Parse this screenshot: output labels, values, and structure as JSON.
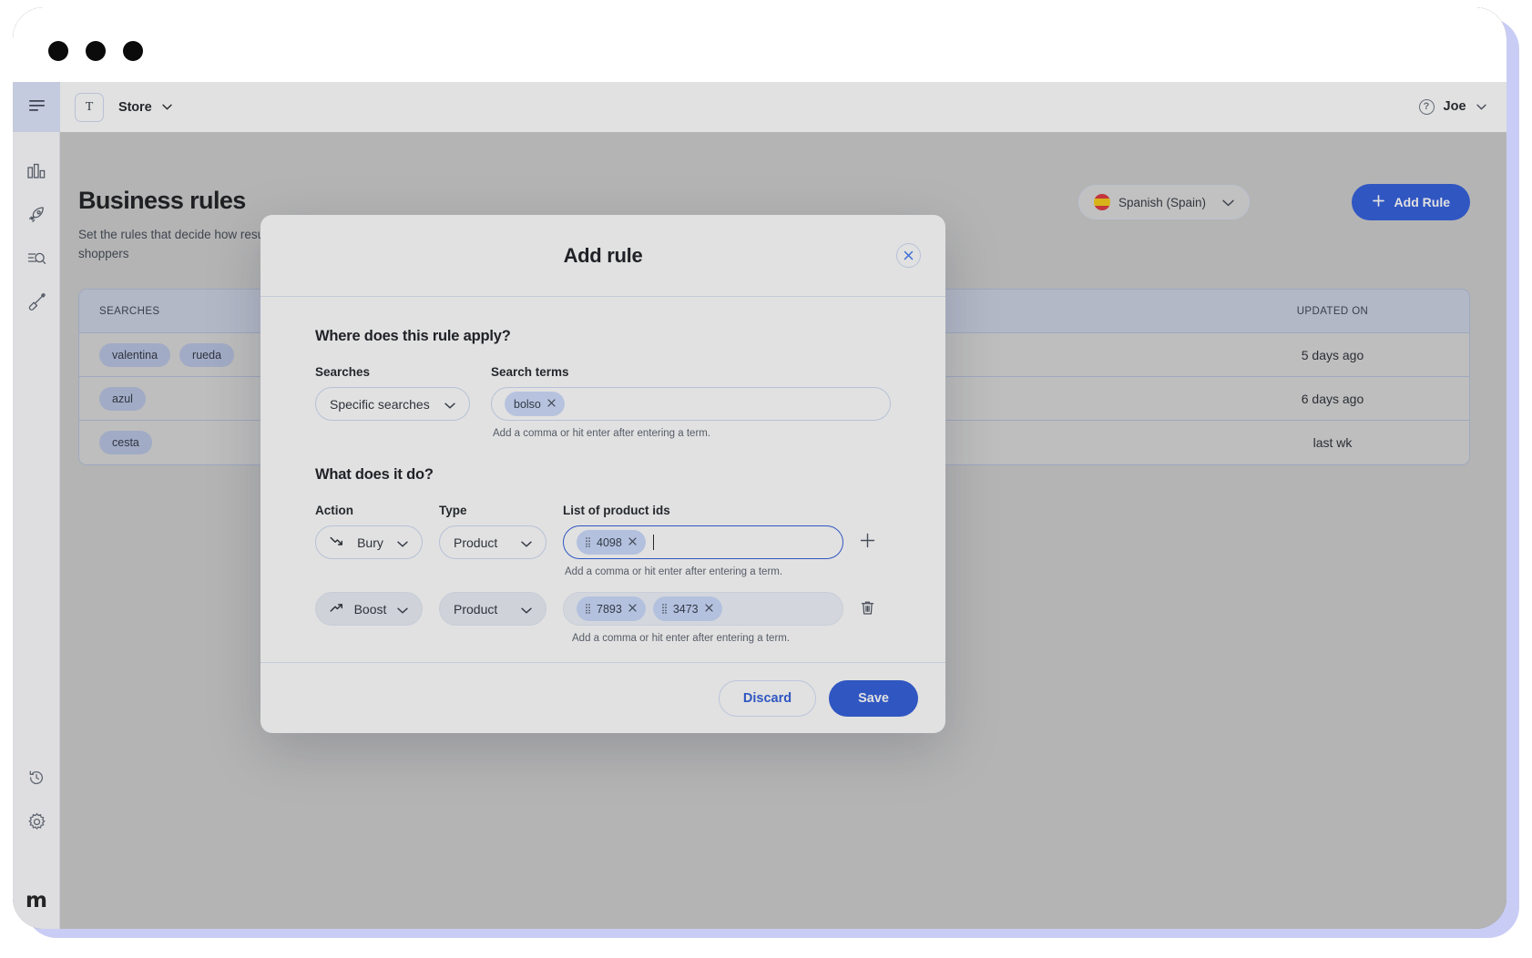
{
  "window": {
    "traffic_lights": [
      "close",
      "minimize",
      "maximize"
    ]
  },
  "appbar": {
    "store_tile_letter": "T",
    "store_name": "Store",
    "store_chevron": "chevron-down-icon",
    "help_glyph": "?",
    "user_name": "Joe",
    "user_chevron": "chevron-down-icon"
  },
  "sidebar": {
    "items": [
      {
        "icon": "hamburger-menu-icon",
        "name": "menu",
        "active": true
      },
      {
        "icon": "bar-chart-icon",
        "name": "analytics"
      },
      {
        "icon": "rocket-icon",
        "name": "boost"
      },
      {
        "icon": "search-document-icon",
        "name": "search-insights"
      },
      {
        "icon": "paintbrush-icon",
        "name": "appearance"
      }
    ],
    "bottom_items": [
      {
        "icon": "history-icon",
        "name": "history"
      },
      {
        "icon": "gear-icon",
        "name": "settings"
      }
    ],
    "logo": "m"
  },
  "page": {
    "title": "Business rules",
    "subtitle": "Set the rules that decide how results are displayed to shoppers",
    "language_selector": {
      "flag": "spain-flag-icon",
      "value": "Spanish (Spain)",
      "chevron": "chevron-down-icon"
    },
    "add_rule_button": {
      "label": "Add Rule",
      "icon": "plus-icon"
    },
    "table": {
      "columns": [
        "SEARCHES",
        "UPDATED ON"
      ],
      "rows": [
        {
          "tags": [
            "valentina",
            "rueda"
          ],
          "updated": "5 days ago"
        },
        {
          "tags": [
            "azul"
          ],
          "updated": "6 days ago"
        },
        {
          "tags": [
            "cesta"
          ],
          "updated": "last wk"
        }
      ]
    }
  },
  "modal": {
    "title": "Add rule",
    "close_icon": "close-icon",
    "section_where": {
      "heading": "Where does this rule apply?",
      "searches_label": "Searches",
      "searches_value": "Specific searches",
      "search_terms_label": "Search terms",
      "search_terms_tokens": [
        "bolso"
      ],
      "hint": "Add a comma or hit enter after entering a term."
    },
    "section_what": {
      "heading": "What does it do?",
      "action_label": "Action",
      "type_label": "Type",
      "ids_label": "List of product ids",
      "hint": "Add a comma or hit enter after entering a term.",
      "rows": [
        {
          "action": "Bury",
          "action_icon": "trend-down-icon",
          "type": "Product",
          "ids": [
            "4098"
          ],
          "focused": true,
          "trailing_icon": "plus-icon"
        },
        {
          "action": "Boost",
          "action_icon": "trend-up-icon",
          "type": "Product",
          "ids": [
            "7893",
            "3473"
          ],
          "focused": false,
          "trailing_icon": "trash-icon"
        }
      ]
    },
    "footer": {
      "discard_label": "Discard",
      "save_label": "Save"
    }
  },
  "colors": {
    "accent": "#1d4ed8",
    "token_bg": "#c5d6fb",
    "page_bg": "#c6c6c6",
    "table_header": "#c4cbde"
  }
}
